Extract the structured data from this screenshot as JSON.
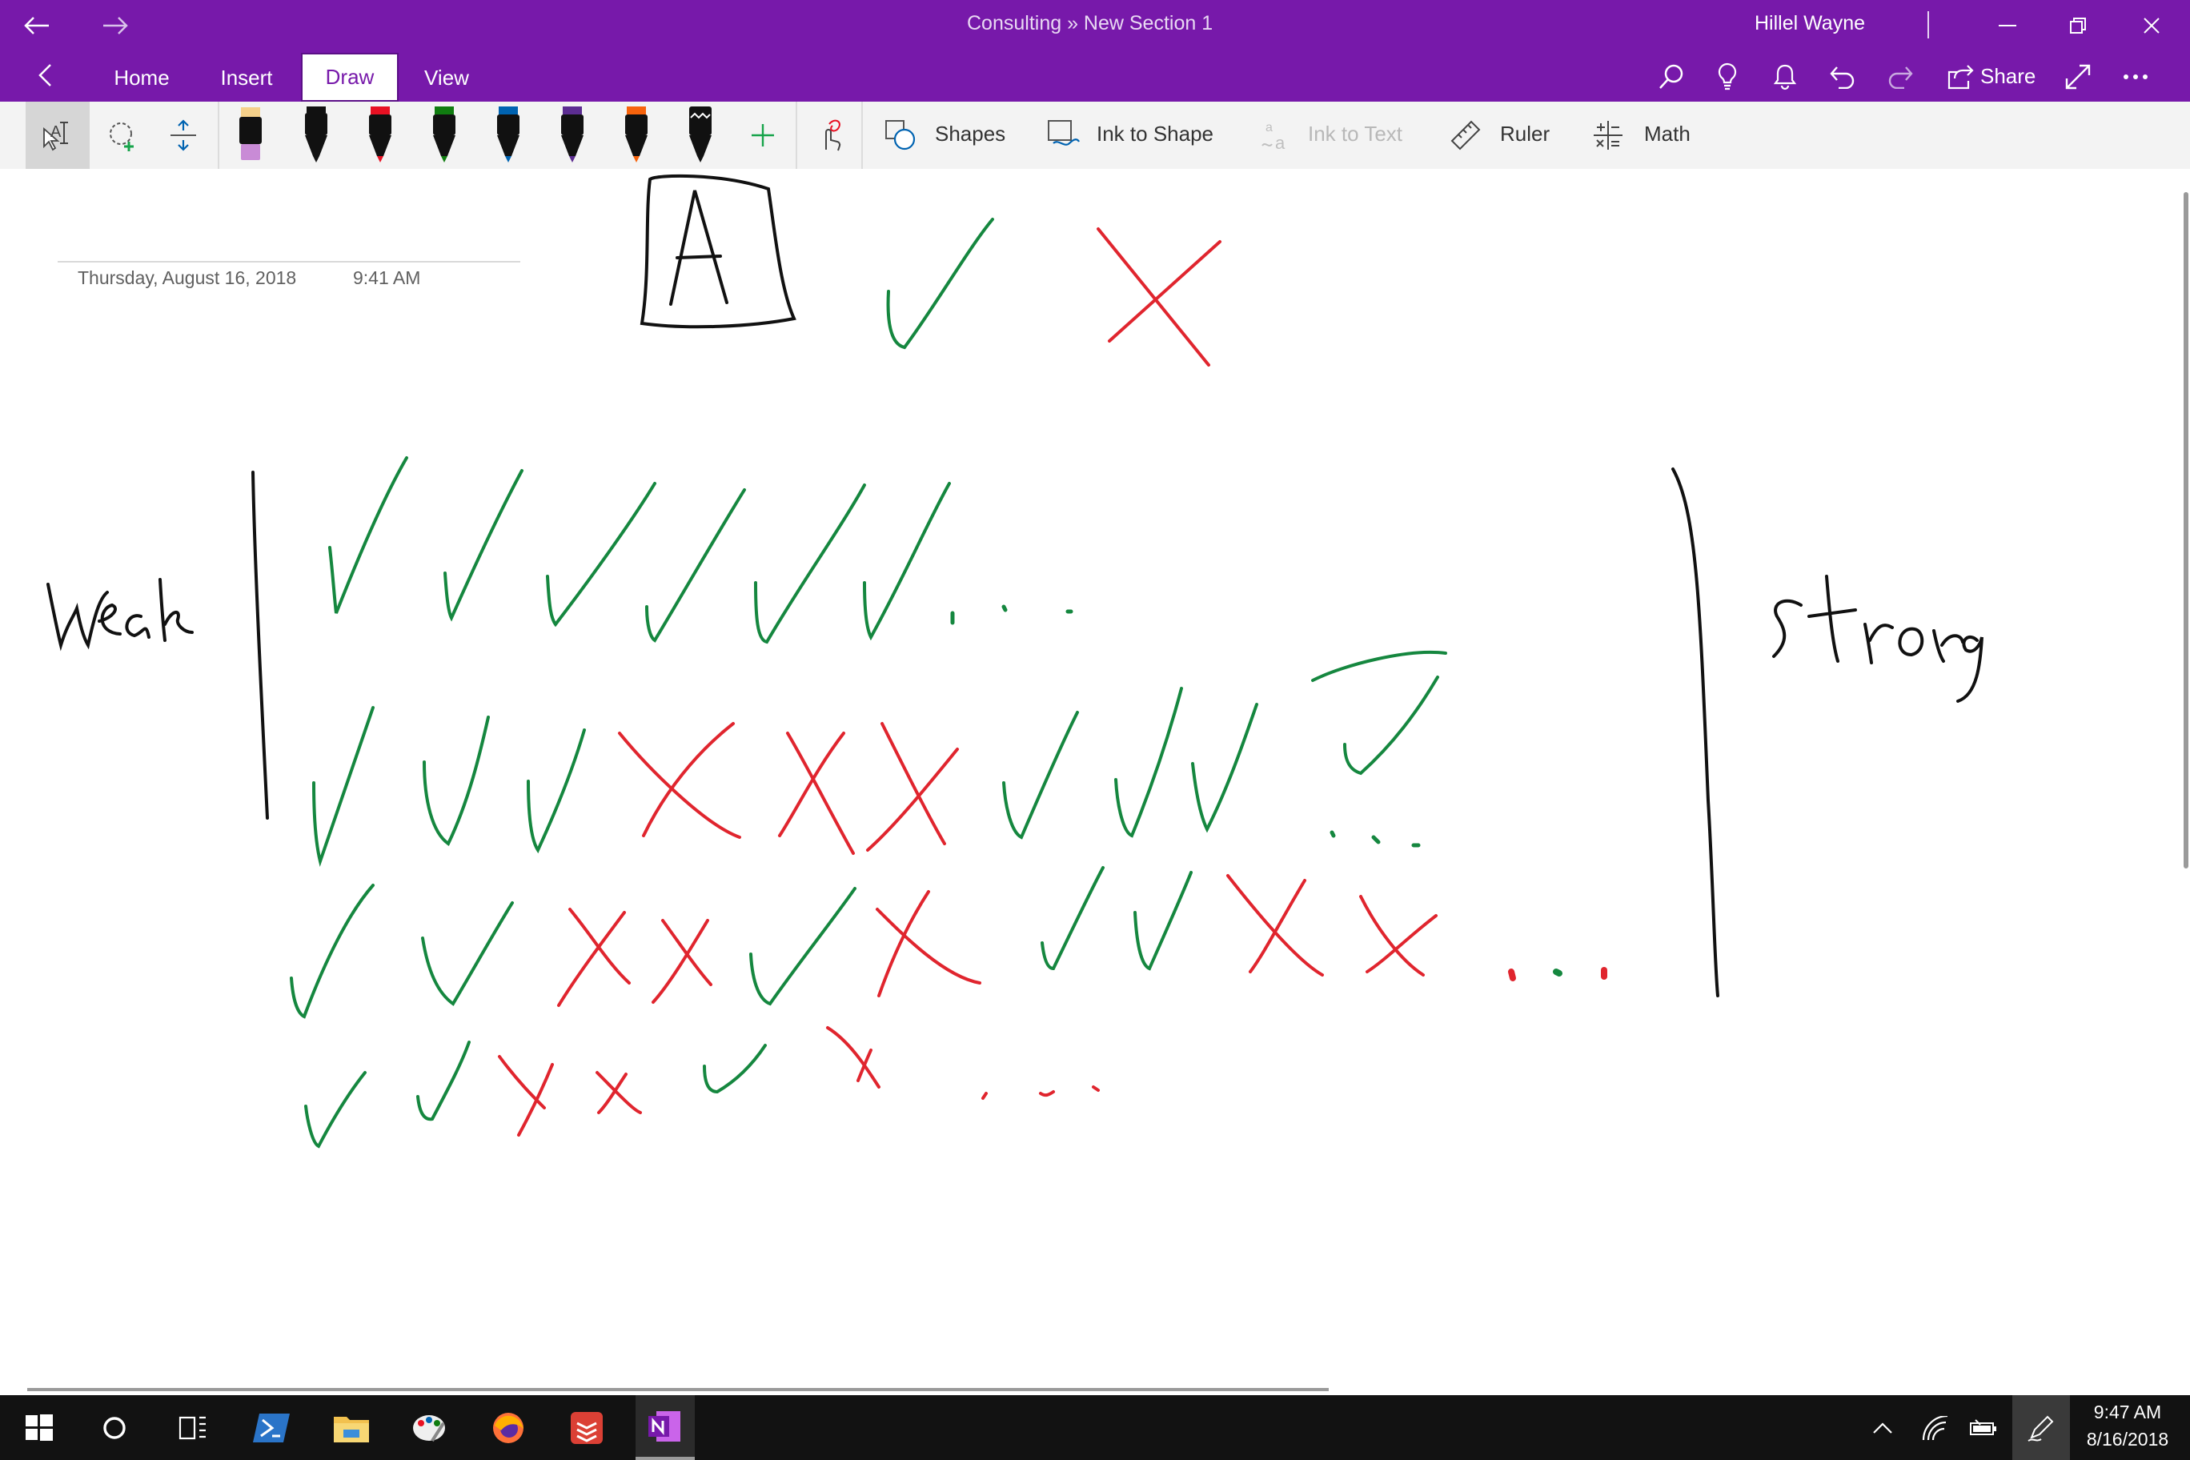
{
  "window": {
    "title": "Consulting » New Section 1",
    "user": "Hillel Wayne"
  },
  "tabs": [
    {
      "label": "Home"
    },
    {
      "label": "Insert"
    },
    {
      "label": "Draw",
      "active": true
    },
    {
      "label": "View"
    }
  ],
  "header_actions": {
    "share_label": "Share"
  },
  "ribbon": {
    "shapes_label": "Shapes",
    "ink_to_shape_label": "Ink to Shape",
    "ink_to_text_label": "Ink to Text",
    "ruler_label": "Ruler",
    "math_label": "Math",
    "pens": [
      {
        "color": "#E6A8E6"
      },
      {
        "color": "#111111"
      },
      {
        "color": "#E81123"
      },
      {
        "color": "#107C10"
      },
      {
        "color": "#0063B1"
      },
      {
        "color": "#5C2D91"
      },
      {
        "color": "#F7630C"
      },
      {
        "color": "#111111"
      }
    ]
  },
  "page": {
    "date": "Thursday, August 16, 2018",
    "time": "9:41 AM",
    "ink_words": {
      "left": "Weak",
      "right": "Strong",
      "boxed_letter": "A"
    }
  },
  "colors": {
    "brand": "#7719AA",
    "ink_green": "#15873F",
    "ink_red": "#E0252E",
    "ink_black": "#111111"
  },
  "taskbar": {
    "time": "9:47 AM",
    "date": "8/16/2018",
    "apps": [
      "start-icon",
      "cortana-icon",
      "task-view-icon",
      "powershell-icon",
      "file-explorer-icon",
      "paint-icon",
      "firefox-icon",
      "todoist-icon",
      "onenote-icon"
    ]
  }
}
